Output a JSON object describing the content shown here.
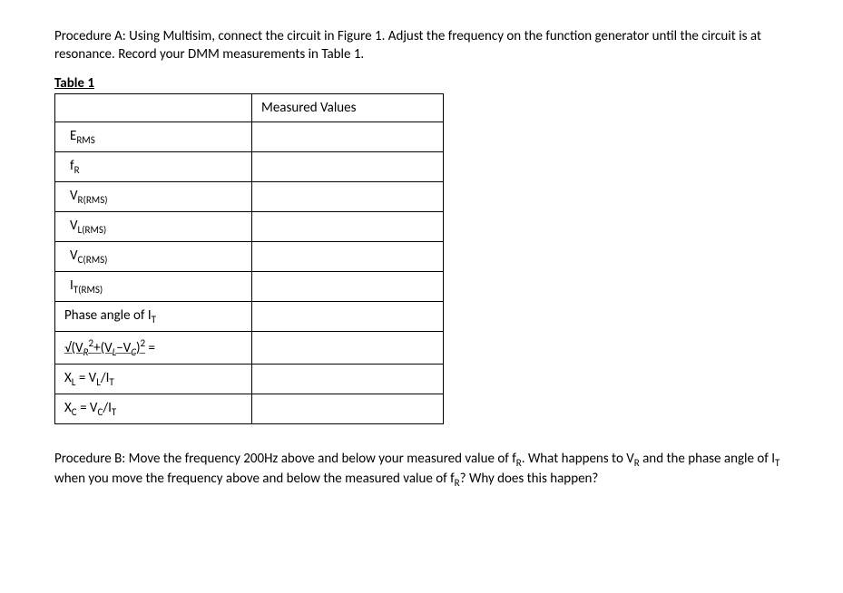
{
  "procedureA": {
    "text": "Procedure A: Using Multisim, connect the circuit in Figure 1.  Adjust the frequency on the function generator until the circuit is at resonance.  Record your DMM measurements in Table 1."
  },
  "table": {
    "caption": "Table 1",
    "header": {
      "label": "",
      "measured": "Measured Values"
    },
    "rows": {
      "erms": "",
      "fr": "",
      "vrrms": "",
      "vlrms": "",
      "vcrms": "",
      "itrms": "",
      "phase": "",
      "sqrt": "",
      "xl": "",
      "xc": ""
    }
  },
  "labels": {
    "phase_pre": "Phase angle of I",
    "phase_sub": "T",
    "sqrt_eq": " =",
    "xl_pre": "X",
    "xl_sub1": "L",
    "xl_mid": " = V",
    "xl_sub2": "L",
    "xl_mid2": "/I",
    "xl_sub3": "T",
    "xc_pre": "X",
    "xc_sub1": "C",
    "xc_mid": " = V",
    "xc_sub2": "C",
    "xc_mid2": "/I",
    "xc_sub3": "T"
  },
  "procedureB": {
    "pre": "Procedure B: Move the frequency 200Hz above and below your measured value of f",
    "sub1": "R",
    "mid1": ".  What happens to V",
    "sub2": "R",
    "mid2": " and the phase angle of I",
    "sub3": "T",
    "mid3": " when you move the frequency above and below the measured value of f",
    "sub4": "R",
    "post": "? Why does this happen?"
  }
}
